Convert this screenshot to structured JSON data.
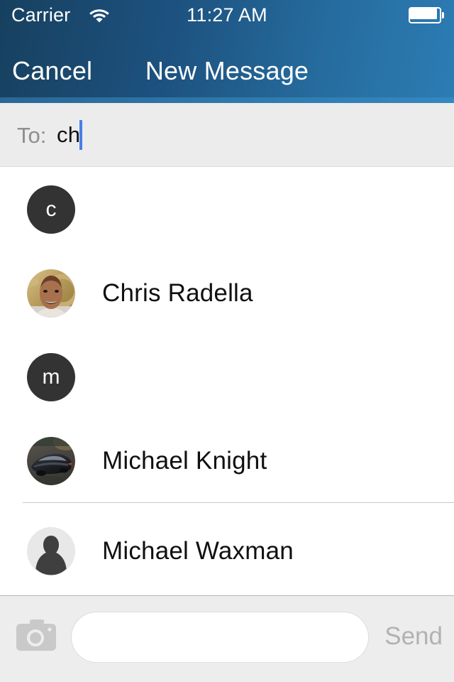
{
  "status_bar": {
    "carrier": "Carrier",
    "wifi_icon": "wifi-icon",
    "time": "11:27 AM",
    "battery_icon": "battery-icon"
  },
  "nav_bar": {
    "cancel_label": "Cancel",
    "title": "New Message"
  },
  "recipient_field": {
    "label": "To:",
    "value": "ch",
    "caret_visible": true
  },
  "contacts": [
    {
      "avatar_type": "initial",
      "initial": "c",
      "name": ""
    },
    {
      "avatar_type": "photo-person",
      "initial": "",
      "name": "Chris Radella"
    },
    {
      "avatar_type": "initial",
      "initial": "m",
      "name": ""
    },
    {
      "avatar_type": "photo-car",
      "initial": "",
      "name": "Michael Knight"
    },
    {
      "avatar_type": "silhouette",
      "initial": "",
      "name": "Michael Waxman"
    }
  ],
  "toolbar": {
    "camera_icon": "camera-icon",
    "message_placeholder": "",
    "message_value": "",
    "send_label": "Send"
  },
  "colors": {
    "nav_gradient_start": "#17405f",
    "nav_gradient_end": "#2c7cb4",
    "to_field_bg": "#ececec",
    "caret": "#4a7fe8",
    "avatar_initial_bg": "#333333",
    "send_disabled": "#b2b2b2",
    "toolbar_bg": "#ededed",
    "separator": "#c8c8c8"
  }
}
